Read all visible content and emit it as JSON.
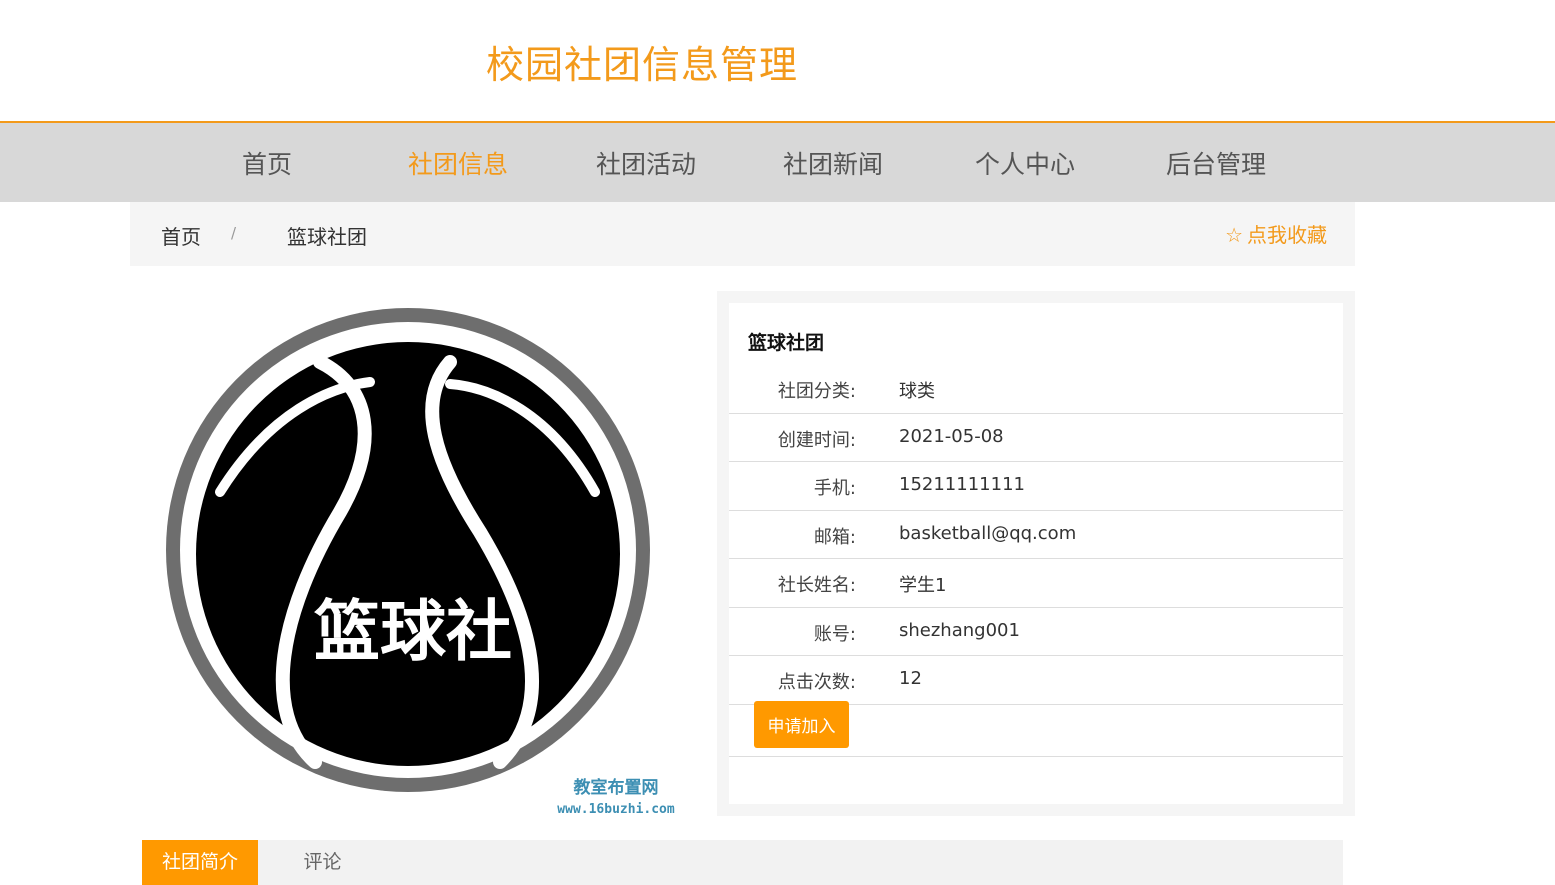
{
  "header": {
    "site_title": "校园社团信息管理"
  },
  "nav": {
    "items": [
      {
        "label": "首页"
      },
      {
        "label": "社团信息"
      },
      {
        "label": "社团活动"
      },
      {
        "label": "社团新闻"
      },
      {
        "label": "个人中心"
      },
      {
        "label": "后台管理"
      }
    ],
    "active_index": 1
  },
  "breadcrumb": {
    "home": "首页",
    "separator": "/",
    "current": "篮球社团",
    "favorite_icon": "star-outline-icon",
    "favorite_label": "点我收藏"
  },
  "logo": {
    "text": "篮球社",
    "watermark_line1": "教室布置网",
    "watermark_line2": "www.16buzhi.com"
  },
  "club": {
    "name": "篮球社团",
    "fields": [
      {
        "label": "社团分类:",
        "value": "球类"
      },
      {
        "label": "创建时间:",
        "value": "2021-05-08"
      },
      {
        "label": "手机:",
        "value": "15211111111"
      },
      {
        "label": "邮箱:",
        "value": "basketball@qq.com"
      },
      {
        "label": "社长姓名:",
        "value": "学生1"
      },
      {
        "label": "账号:",
        "value": "shezhang001"
      },
      {
        "label": "点击次数:",
        "value": "12"
      }
    ],
    "apply_label": "申请加入"
  },
  "tabs": [
    {
      "label": "社团简介"
    },
    {
      "label": "评论"
    }
  ],
  "colors": {
    "accent": "#f39a1b",
    "button": "#ff9900",
    "nav_bg": "#d8d8d8"
  }
}
